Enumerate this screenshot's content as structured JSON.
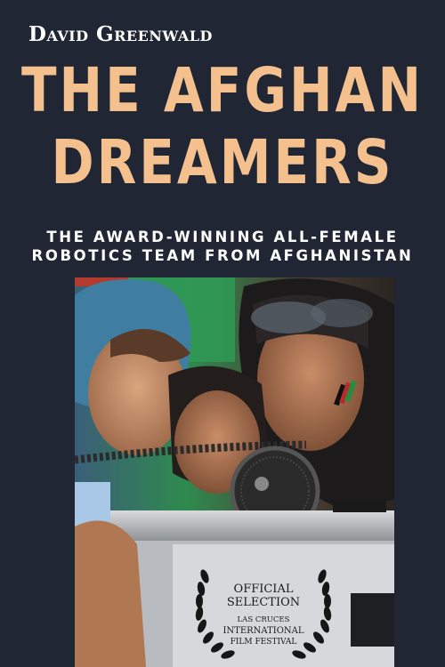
{
  "cover": {
    "author": "David Greenwald",
    "title_line1": "THE AFGHAN",
    "title_line2": "DREAMERS",
    "subtitle_line1": "THE AWARD-WINNING ALL-FEMALE",
    "subtitle_line2": "ROBOTICS TEAM FROM AFGHANISTAN"
  },
  "laurel": {
    "line1": "OFFICIAL",
    "line2": "SELECTION",
    "line3": "LAS CRUCES",
    "line4": "INTERNATIONAL",
    "line5": "FILM FESTIVAL"
  },
  "colors": {
    "background": "#212634",
    "title": "#f3c08e",
    "text": "#ffffff"
  }
}
